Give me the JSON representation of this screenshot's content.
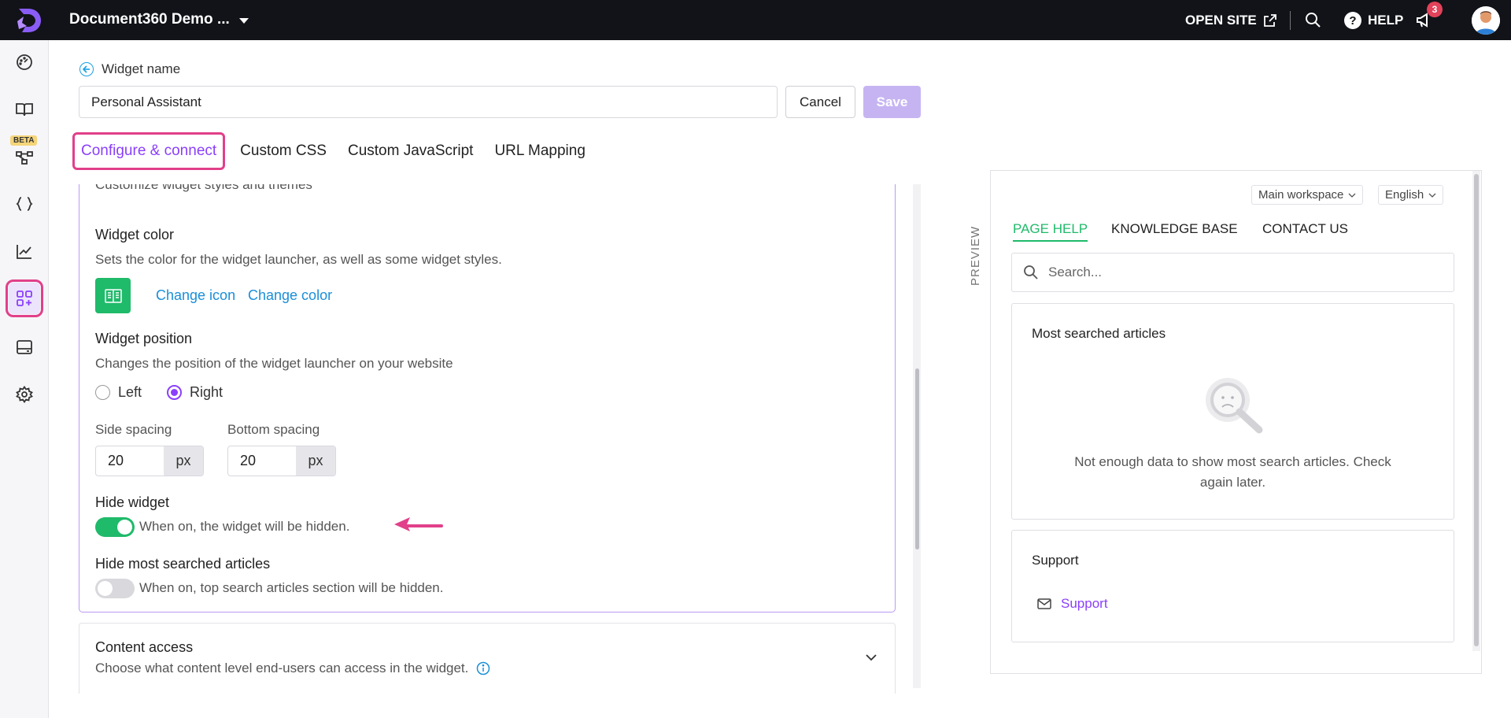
{
  "topbar": {
    "project_name": "Document360 Demo ...",
    "open_site": "OPEN SITE",
    "help": "HELP",
    "notifications_count": "3"
  },
  "sidebar": {
    "beta_badge": "BETA",
    "items": [
      {
        "icon": "dashboard-icon"
      },
      {
        "icon": "book-icon"
      },
      {
        "icon": "workflow-icon"
      },
      {
        "icon": "code-braces-icon"
      },
      {
        "icon": "analytics-icon"
      },
      {
        "icon": "widgets-icon",
        "active": true
      },
      {
        "icon": "layout-icon"
      },
      {
        "icon": "settings-icon"
      }
    ]
  },
  "header": {
    "back_label": "Widget name",
    "widget_name_value": "Personal Assistant",
    "cancel_label": "Cancel",
    "save_label": "Save"
  },
  "tabs": [
    {
      "label": "Configure & connect",
      "active": true
    },
    {
      "label": "Custom CSS"
    },
    {
      "label": "Custom JavaScript"
    },
    {
      "label": "URL Mapping"
    }
  ],
  "config": {
    "style_desc": "Customize widget styles and themes",
    "widget_color_label": "Widget color",
    "widget_color_desc": "Sets the color for the widget launcher, as well as some widget styles.",
    "widget_color_value": "#1fba6a",
    "change_icon": "Change icon",
    "change_color": "Change color",
    "position_label": "Widget position",
    "position_desc": "Changes the position of the widget launcher on your website",
    "position_left": "Left",
    "position_right": "Right",
    "position_selected": "Right",
    "side_spacing_label": "Side spacing",
    "side_spacing_value": "20",
    "bottom_spacing_label": "Bottom spacing",
    "bottom_spacing_value": "20",
    "unit": "px",
    "hide_widget_label": "Hide widget",
    "hide_widget_desc": "When on, the widget will be hidden.",
    "hide_widget_on": true,
    "hide_searched_label": "Hide most searched articles",
    "hide_searched_desc": "When on, top search articles section will be hidden.",
    "hide_searched_on": false
  },
  "content_access": {
    "title": "Content access",
    "desc": "Choose what content level end-users can access in the widget."
  },
  "preview": {
    "label": "PREVIEW",
    "workspace": "Main workspace",
    "language": "English",
    "tabs": [
      "PAGE HELP",
      "KNOWLEDGE BASE",
      "CONTACT US"
    ],
    "search_placeholder": "Search...",
    "most_searched_title": "Most searched articles",
    "empty_line1": "Not enough data to show most search articles. Check",
    "empty_line2": "again later.",
    "support_title": "Support",
    "support_link": "Support"
  }
}
